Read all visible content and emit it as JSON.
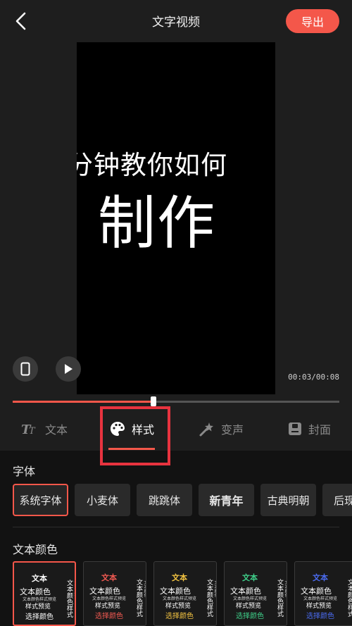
{
  "header": {
    "title": "文字视频",
    "export_label": "导出"
  },
  "video": {
    "line1": "分钟教你如何",
    "line2": "制作",
    "time": "00:03/00:08",
    "progress": 0.43
  },
  "tabs": [
    {
      "label": "文本",
      "icon": "text-tt-icon",
      "active": false
    },
    {
      "label": "样式",
      "icon": "palette-icon",
      "active": true
    },
    {
      "label": "变声",
      "icon": "voice-effect-icon",
      "active": false
    },
    {
      "label": "封面",
      "icon": "cover-icon",
      "active": false
    }
  ],
  "font_section": {
    "label": "字体",
    "fonts": [
      "系统字体",
      "小麦体",
      "跳跳体",
      "新青年",
      "古典明朝",
      "后现"
    ],
    "selected_index": 0
  },
  "color_section": {
    "label": "文本颜色",
    "card_text": {
      "title": "文本",
      "main": "文本颜色",
      "small": "文本颜色样式预览",
      "line3": "样式预览",
      "line4": "选择颜色",
      "vert1": "文本颜色样式",
      "vert2": "文本颜色"
    },
    "cards": [
      {
        "title_color": "#ffffff",
        "line4_color": "#ffffff"
      },
      {
        "title_color": "#f25a52",
        "line4_color": "#f25a52"
      },
      {
        "title_color": "#f5c542",
        "line4_color": "#f5c542"
      },
      {
        "title_color": "#3fd08a",
        "line4_color": "#3fd08a"
      },
      {
        "title_color": "#4b6cf2",
        "line4_color": "#4b6cf2"
      }
    ],
    "selected_index": 0
  },
  "colors": {
    "accent": "#f4574a",
    "annotation_box": "#e8333f"
  }
}
